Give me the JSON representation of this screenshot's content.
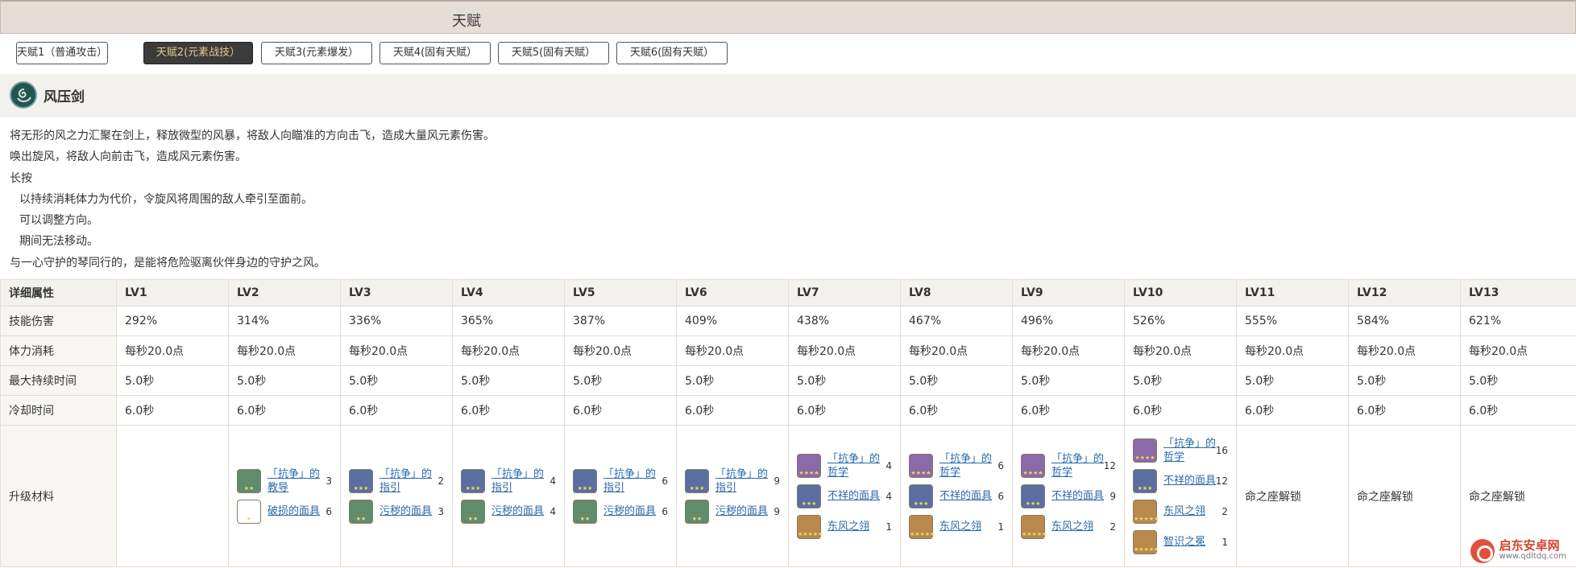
{
  "header": {
    "title": "天赋"
  },
  "tabs": [
    {
      "label": "天赋1（普通攻击）",
      "active": false
    },
    {
      "label": "天赋2(元素战技）",
      "active": true
    },
    {
      "label": "天赋3(元素爆发）",
      "active": false
    },
    {
      "label": "天赋4(固有天赋）",
      "active": false
    },
    {
      "label": "天赋5(固有天赋）",
      "active": false
    },
    {
      "label": "天赋6(固有天赋）",
      "active": false
    }
  ],
  "skill": {
    "icon": "anemo-swirl-icon",
    "name": "风压剑",
    "description": [
      "将无形的风之力汇聚在剑上，释放微型的风暴，将敌人向瞄准的方向击飞，造成大量风元素伤害。",
      "唤出旋风，将敌人向前击飞，造成风元素伤害。",
      "长按",
      "以持续消耗体力为代价，令旋风将周围的敌人牵引至面前。",
      "可以调整方向。",
      "期间无法移动。",
      "与一心守护的琴同行的，是能将危险驱离伙伴身边的守护之风。"
    ]
  },
  "table": {
    "header": [
      "详细属性",
      "LV1",
      "LV2",
      "LV3",
      "LV4",
      "LV5",
      "LV6",
      "LV7",
      "LV8",
      "LV9",
      "LV10",
      "LV11",
      "LV12",
      "LV13"
    ],
    "rows": [
      {
        "label": "技能伤害",
        "values": [
          "292%",
          "314%",
          "336%",
          "365%",
          "387%",
          "409%",
          "438%",
          "467%",
          "496%",
          "526%",
          "555%",
          "584%",
          "621%"
        ]
      },
      {
        "label": "体力消耗",
        "values": [
          "每秒20.0点",
          "每秒20.0点",
          "每秒20.0点",
          "每秒20.0点",
          "每秒20.0点",
          "每秒20.0点",
          "每秒20.0点",
          "每秒20.0点",
          "每秒20.0点",
          "每秒20.0点",
          "每秒20.0点",
          "每秒20.0点",
          "每秒20.0点"
        ]
      },
      {
        "label": "最大持续时间",
        "values": [
          "5.0秒",
          "5.0秒",
          "5.0秒",
          "5.0秒",
          "5.0秒",
          "5.0秒",
          "5.0秒",
          "5.0秒",
          "5.0秒",
          "5.0秒",
          "5.0秒",
          "5.0秒",
          "5.0秒"
        ]
      },
      {
        "label": "冷却时间",
        "values": [
          "6.0秒",
          "6.0秒",
          "6.0秒",
          "6.0秒",
          "6.0秒",
          "6.0秒",
          "6.0秒",
          "6.0秒",
          "6.0秒",
          "6.0秒",
          "6.0秒",
          "6.0秒",
          "6.0秒"
        ]
      }
    ],
    "materials_label": "升级材料",
    "materials": [
      [],
      [
        {
          "name": "「抗争」的教导",
          "count": "3",
          "rarity": 2
        },
        {
          "name": "破损的面具",
          "count": "6",
          "rarity": 1
        }
      ],
      [
        {
          "name": "「抗争」的指引",
          "count": "2",
          "rarity": 3
        },
        {
          "name": "污秽的面具",
          "count": "3",
          "rarity": 2
        }
      ],
      [
        {
          "name": "「抗争」的指引",
          "count": "4",
          "rarity": 3
        },
        {
          "name": "污秽的面具",
          "count": "4",
          "rarity": 2
        }
      ],
      [
        {
          "name": "「抗争」的指引",
          "count": "6",
          "rarity": 3
        },
        {
          "name": "污秽的面具",
          "count": "6",
          "rarity": 2
        }
      ],
      [
        {
          "name": "「抗争」的指引",
          "count": "9",
          "rarity": 3
        },
        {
          "name": "污秽的面具",
          "count": "9",
          "rarity": 2
        }
      ],
      [
        {
          "name": "「抗争」的哲学",
          "count": "4",
          "rarity": 4
        },
        {
          "name": "不祥的面具",
          "count": "4",
          "rarity": 3
        },
        {
          "name": "东风之翎",
          "count": "1",
          "rarity": 5
        }
      ],
      [
        {
          "name": "「抗争」的哲学",
          "count": "6",
          "rarity": 4
        },
        {
          "name": "不祥的面具",
          "count": "6",
          "rarity": 3
        },
        {
          "name": "东风之翎",
          "count": "1",
          "rarity": 5
        }
      ],
      [
        {
          "name": "「抗争」的哲学",
          "count": "12",
          "rarity": 4
        },
        {
          "name": "不祥的面具",
          "count": "9",
          "rarity": 3
        },
        {
          "name": "东风之翎",
          "count": "2",
          "rarity": 5
        }
      ],
      [
        {
          "name": "「抗争」的哲学",
          "count": "16",
          "rarity": 4
        },
        {
          "name": "不祥的面具",
          "count": "12",
          "rarity": 3
        },
        {
          "name": "东风之翎",
          "count": "2",
          "rarity": 5
        },
        {
          "name": "智识之冕",
          "count": "1",
          "rarity": 5
        }
      ],
      "命之座解锁",
      "命之座解锁",
      "命之座解锁"
    ]
  },
  "watermark": {
    "name": "启东安卓网",
    "url": "www.qdltdq.com"
  }
}
